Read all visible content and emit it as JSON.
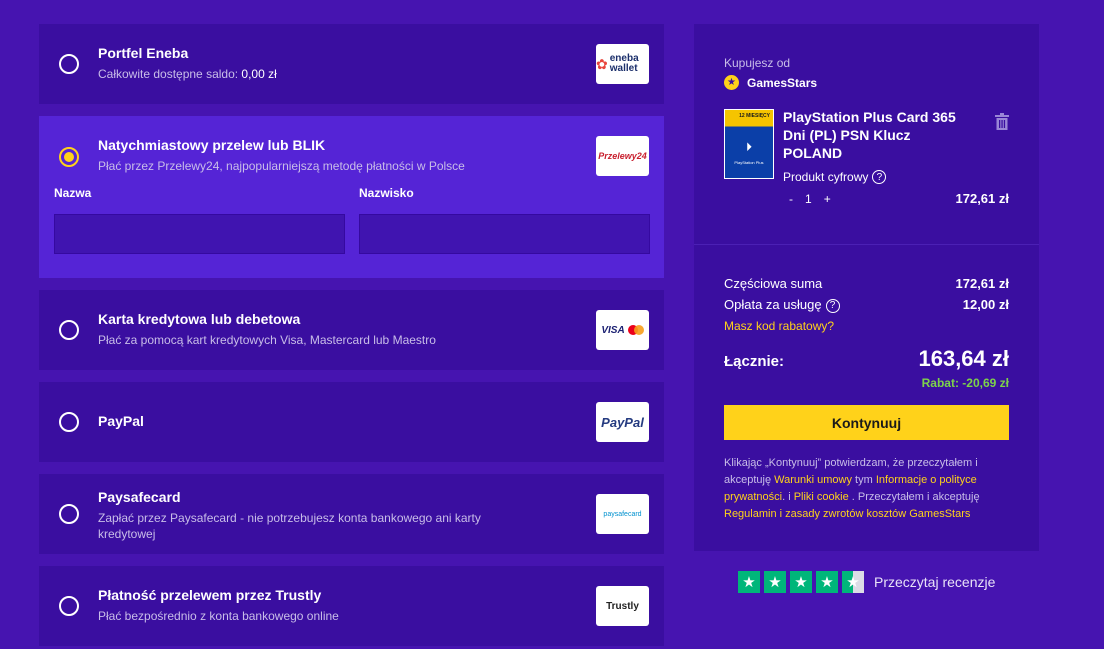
{
  "payment_methods": [
    {
      "title": "Portfel Eneba",
      "desc_prefix": "Całkowite dostępne saldo: ",
      "desc_value": "0,00 zł",
      "logo": "eneba wallet",
      "selected": false
    },
    {
      "title": "Natychmiastowy przelew lub BLIK",
      "desc": "Płać przez Przelewy24, najpopularniejszą metodę płatności w Polsce",
      "logo": "Przelewy24",
      "selected": true,
      "fields": {
        "first_name_label": "Nazwa",
        "last_name_label": "Nazwisko",
        "first_name_value": "",
        "last_name_value": ""
      }
    },
    {
      "title": "Karta kredytowa lub debetowa",
      "desc": "Płać za pomocą kart kredytowych Visa, Mastercard lub Maestro",
      "logo": "VISA",
      "selected": false
    },
    {
      "title": "PayPal",
      "desc": "",
      "logo": "PayPal",
      "selected": false
    },
    {
      "title": "Paysafecard",
      "desc": "Zapłać przez Paysafecard - nie potrzebujesz konta bankowego ani karty kredytowej",
      "logo": "paysafecard",
      "selected": false
    },
    {
      "title": "Płatność przelewem przez Trustly",
      "desc": "Płać bezpośrednio z konta bankowego online",
      "logo": "Trustly",
      "selected": false
    }
  ],
  "summary": {
    "buying_from_label": "Kupujesz od",
    "seller": "GamesStars",
    "product": {
      "name": "PlayStation Plus Card 365 Dni (PL) PSN Klucz POLAND",
      "type": "Produkt cyfrowy",
      "qty_minus": "-",
      "qty": "1",
      "qty_plus": "+",
      "price": "172,61 zł",
      "thumb_badge": "12 MIESIĘCY",
      "thumb_brand": "PlayStation Plus"
    },
    "subtotal_label": "Częściowa suma",
    "subtotal_value": "172,61 zł",
    "fee_label": "Opłata za usługę",
    "fee_value": "12,00 zł",
    "coupon_link": "Masz kod rabatowy?",
    "total_label": "Łącznie:",
    "total_value": "163,64 zł",
    "discount": "Rabat: -20,69 zł",
    "continue_label": "Kontynuuj",
    "legal": {
      "p1": "Klikając „Kontynuuj” potwierdzam, że przeczytałem i akceptuję ",
      "l1": "Warunki umowy",
      "p2": " tym ",
      "l2": "Informacje o polityce prywatności",
      "p3": ". i ",
      "l3": "Pliki cookie",
      "p4": " . Przeczytałem i akceptuję ",
      "l4": "Regulamin i zasady zwrotów kosztów GamesStars"
    }
  },
  "trustpilot": {
    "text": "Przeczytaj recenzje",
    "stars": 4.5
  },
  "colors": {
    "bg": "#4614b0",
    "panel": "#3a0ea0",
    "selected_panel": "#5524d6",
    "accent": "#ffd21a",
    "discount": "#7dd24a"
  }
}
